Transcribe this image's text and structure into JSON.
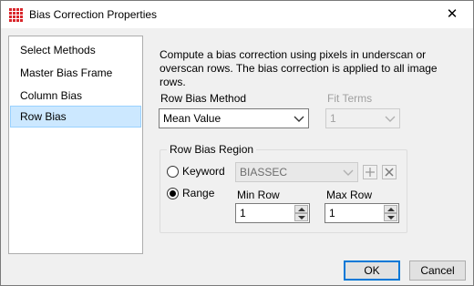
{
  "window": {
    "title": "Bias Correction Properties",
    "close_glyph": "✕",
    "icon": "app-grid-icon",
    "icon_color": "#d9262b"
  },
  "nav": {
    "items": [
      {
        "label": "Select Methods",
        "selected": false
      },
      {
        "label": "Master Bias Frame",
        "selected": false
      },
      {
        "label": "Column Bias",
        "selected": false
      },
      {
        "label": "Row Bias",
        "selected": true
      }
    ]
  },
  "description": "Compute a bias correction using pixels in underscan or overscan rows. The bias correction is applied to all image rows.",
  "row_bias_method": {
    "label": "Row Bias Method",
    "value": "Mean Value"
  },
  "fit_terms": {
    "label": "Fit Terms",
    "value": "1",
    "enabled": false
  },
  "region": {
    "title": "Row Bias Region",
    "keyword": {
      "label": "Keyword",
      "selected": false,
      "value": "BIASSEC",
      "add_icon": "plus-icon",
      "remove_icon": "x-icon"
    },
    "range": {
      "label": "Range",
      "selected": true,
      "min_row": {
        "label": "Min Row",
        "value": "1"
      },
      "max_row": {
        "label": "Max Row",
        "value": "1"
      }
    }
  },
  "buttons": {
    "ok": "OK",
    "cancel": "Cancel"
  }
}
